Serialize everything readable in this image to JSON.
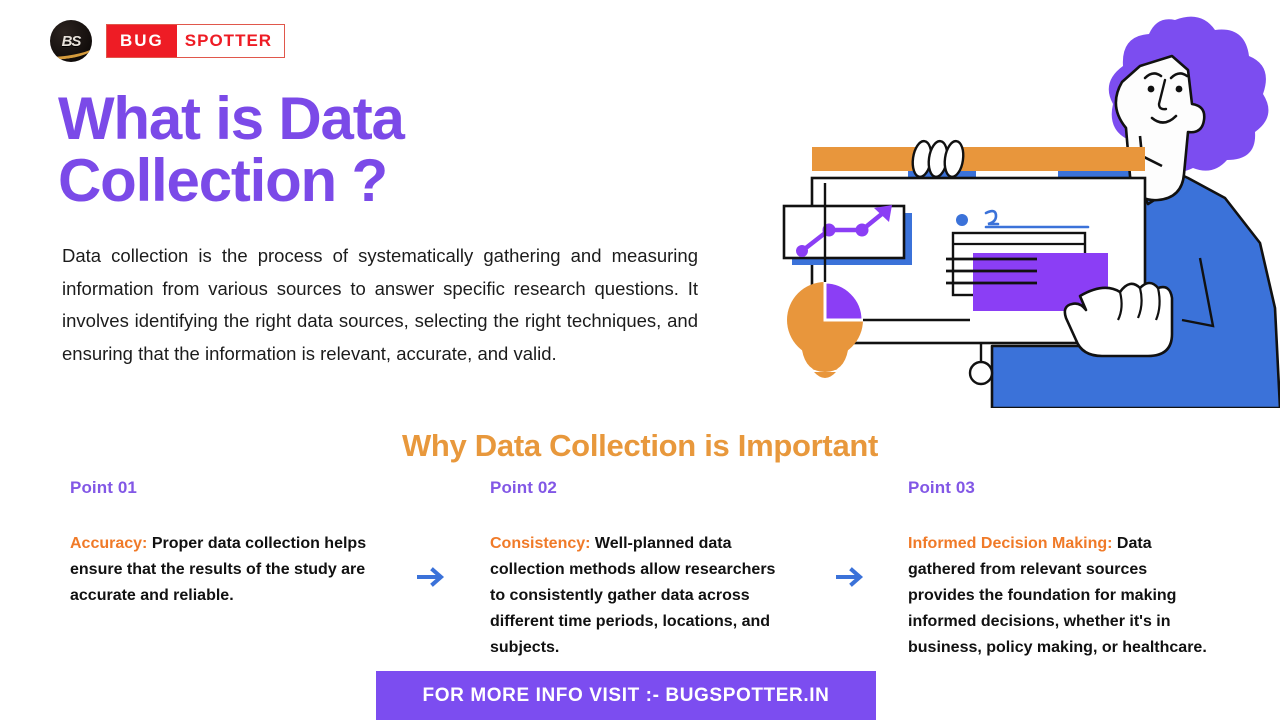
{
  "brand": {
    "badge_text": "BS",
    "wordmark_first": "BUG",
    "wordmark_second": "SPOTTER"
  },
  "header": {
    "title_line_1": "What is Data",
    "title_line_2": "Collection ?",
    "title_color": "#7b4ae8"
  },
  "intro": {
    "paragraph": "Data collection is the process of systematically gathering and measuring information from various sources to answer specific research questions. It involves identifying the right data sources, selecting the right techniques, and ensuring that the information is relevant, accurate, and valid."
  },
  "section": {
    "heading": "Why Data Collection is Important",
    "heading_color": "#e8983c"
  },
  "points": [
    {
      "label": "Point 01",
      "term": "Accuracy:",
      "text": " Proper data collection helps ensure that the results of the study are accurate and reliable."
    },
    {
      "label": "Point 02",
      "term": "Consistency:",
      "text": " Well-planned data collection methods allow researchers to consistently gather data across different time periods, locations, and subjects."
    },
    {
      "label": "Point 03",
      "term": "Informed Decision Making:",
      "text": " Data gathered from relevant sources provides the foundation for making informed decisions, whether it's in business, policy making, or healthcare."
    }
  ],
  "separators": [
    {
      "icon": "arrow-right-icon",
      "color": "#3b72d9"
    },
    {
      "icon": "arrow-right-icon",
      "color": "#3b72d9"
    }
  ],
  "cta": {
    "text": "FOR MORE INFO VISIT :- BUGSPOTTER.IN",
    "background": "#7c4df0",
    "text_color": "#ffffff"
  },
  "illustration": {
    "name": "person-presenting-data-board",
    "elements": [
      "person-with-purple-hair",
      "blue-shirt",
      "orange-board-top-bar",
      "white-board",
      "line-chart-rising",
      "lightbulb-pie-chart",
      "data-table-purple-highlight",
      "pointing-hand",
      "gripping-hand",
      "search-bar-line",
      "hanging-circle"
    ],
    "colors": {
      "hair_purple": "#7c4df0",
      "shirt_blue": "#3b72d9",
      "board_orange": "#e8963c",
      "accent_purple": "#8b3ef5",
      "outline": "#111111",
      "skin": "#ffffff"
    }
  }
}
